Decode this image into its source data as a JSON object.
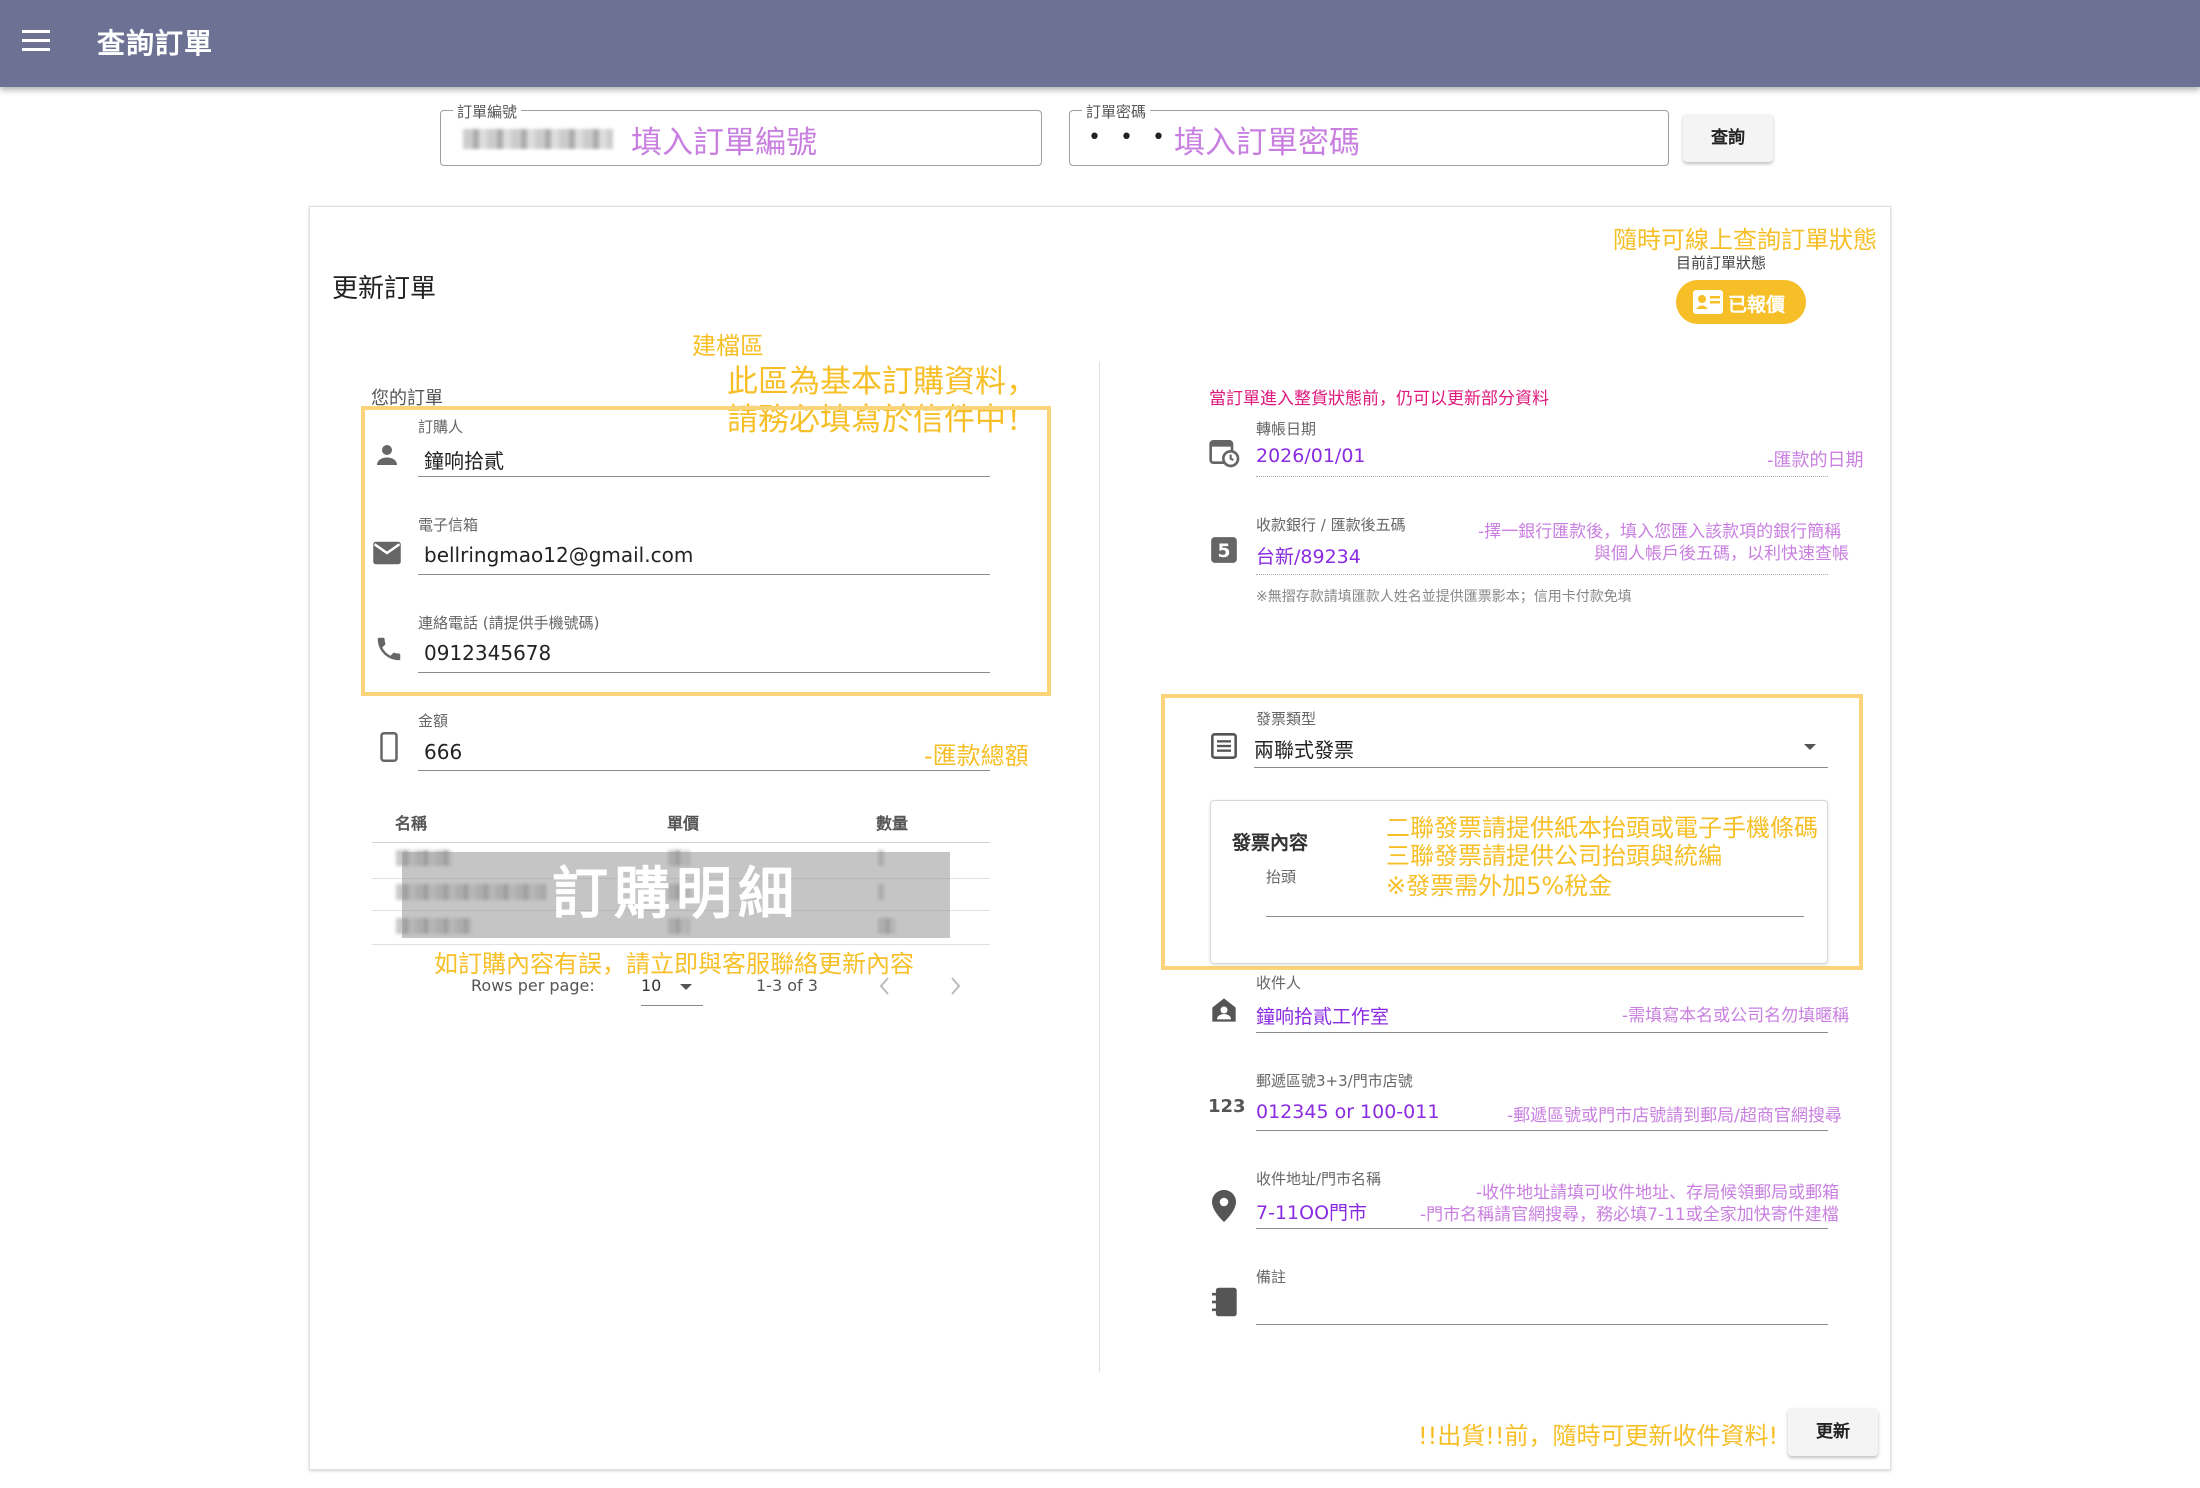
{
  "appbar": {
    "title": "查詢訂單",
    "menu_icon": "menu-icon"
  },
  "query": {
    "order_no_label": "訂單編號",
    "order_no_hint": "填入訂單編號",
    "order_pw_label": "訂單密碼",
    "order_pw_value": "• • •",
    "order_pw_hint": "填入訂單密碼",
    "search_button": "查詢"
  },
  "card": {
    "title": "更新訂單",
    "status_note": "隨時可線上查詢訂單狀態",
    "status_label": "目前訂單狀態",
    "status_badge": "已報價",
    "status_color": "#f7bf27"
  },
  "left": {
    "note_title": "建檔區",
    "note_line1": "此區為基本訂購資料，",
    "note_line2": "請務必填寫於信件中！",
    "section_label": "您的訂單",
    "buyer": {
      "label": "訂購人",
      "value": "鐘响拾貳",
      "icon": "person-icon"
    },
    "email": {
      "label": "電子信箱",
      "value": "bellringmao12@gmail.com",
      "icon": "mail-icon"
    },
    "phone": {
      "label": "連絡電話 (請提供手機號碼)",
      "value": "0912345678",
      "icon": "phone-icon"
    },
    "amount": {
      "label": "金額",
      "value": "666",
      "icon": "phone-android-icon",
      "hint": "-匯款總額"
    },
    "table": {
      "headers": [
        "名稱",
        "單價",
        "數量"
      ],
      "overlay": "訂購明細",
      "note": "如訂購內容有誤，請立即與客服聯絡更新內容",
      "rows_per_page_label": "Rows per page:",
      "rows_per_page_value": "10",
      "range": "1-3 of 3"
    }
  },
  "right": {
    "notice": "當訂單進入整貨狀態前，仍可以更新部分資料",
    "transfer_date": {
      "label": "轉帳日期",
      "value": "2026/01/01",
      "hint": "-匯款的日期",
      "icon": "calendar-clock-icon"
    },
    "bank": {
      "label": "收款銀行 / 匯款後五碼",
      "value": "台新/89234",
      "hint_line1": "-擇一銀行匯款後，填入您匯入該款項的銀行簡稱",
      "hint_line2": "與個人帳戶後五碼，以利快速查帳",
      "footnote": "※無摺存款請填匯款人姓名並提供匯票影本；信用卡付款免填",
      "icon": "looks-5-icon"
    },
    "invoice": {
      "label": "發票類型",
      "value": "兩聯式發票",
      "icon": "receipt-icon",
      "content_title": "發票內容",
      "title_label": "抬頭",
      "note1": "二聯發票請提供紙本抬頭或電子手機條碼",
      "note2": "三聯發票請提供公司抬頭與統編",
      "note3": "※發票需外加5%稅金"
    },
    "recipient": {
      "label": "收件人",
      "value": "鐘响拾貳工作室",
      "hint": "-需填寫本名或公司名勿填暱稱",
      "icon": "contact-home-icon"
    },
    "zip": {
      "label": "郵遞區號3+3/門市店號",
      "value": "012345 or 100-011",
      "hint": "-郵遞區號或門市店號請到郵局/超商官網搜尋",
      "icon": "numbers-icon",
      "icon_text": "123"
    },
    "address": {
      "label": "收件地址/門市名稱",
      "value": "7-11OO門市",
      "hint_line1": "-收件地址請填可收件地址、存局候領郵局或郵箱",
      "hint_line2": "-門市名稱請官網搜尋，務必填7-11或全家加快寄件建檔",
      "icon": "location-pin-icon"
    },
    "memo": {
      "label": "備註",
      "value": "",
      "icon": "notebook-icon"
    }
  },
  "footer": {
    "note": "!!出貨!!前，隨時可更新收件資料!",
    "update_button": "更新"
  }
}
